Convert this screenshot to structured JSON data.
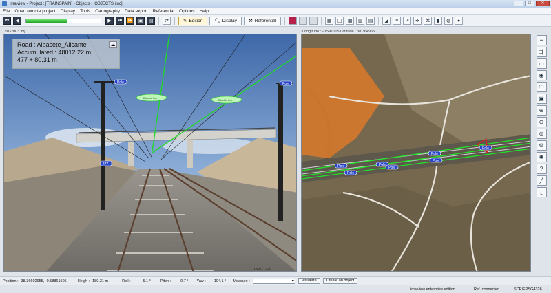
{
  "window": {
    "title": "imajview - Project : [TRAINSPAIN] - Objects : [OBJECTS.itoc]",
    "controls": [
      "–",
      "□",
      "✕"
    ]
  },
  "menu": [
    "File",
    "Open remote project",
    "Display",
    "Tools",
    "Cartography",
    "Data export",
    "Referential",
    "Options",
    "Help"
  ],
  "toolbar": {
    "progress_fraction": 0.55,
    "modes": [
      {
        "label": "Edition",
        "active": true,
        "icon": "pencil-icon"
      },
      {
        "label": "Display",
        "active": false,
        "icon": "magnifier-icon"
      },
      {
        "label": "Referential",
        "active": false,
        "icon": "tools-icon"
      }
    ]
  },
  "left_view": {
    "filename": "s032003.imj",
    "overlay_lines": [
      "Road : Albacete_Alicante",
      "Accumulated : 48012.22 m",
      "477 + 80.31 m"
    ],
    "pixel_readout": "1321,1229",
    "pole_labels": [
      "Pole",
      "Pole",
      "477"
    ],
    "wire_labels": [
      "Electric line",
      "Electric line"
    ]
  },
  "right_view": {
    "coordinates": "Longitude : -0.591015 Latitude : 38.364965",
    "pole_labels": [
      "Pole",
      "Pole",
      "Pole",
      "Pole",
      "Pole",
      "Pole",
      "Pole"
    ]
  },
  "side_tools": [
    "layers-icon",
    "route-icon",
    "ruler-icon",
    "camera-icon",
    "select-icon",
    "image-icon",
    "zoom-in-icon",
    "zoom-out-icon",
    "fit-icon",
    "gear-icon",
    "pin-icon",
    "help-icon",
    "line-icon",
    "corner-icon"
  ],
  "status": {
    "position_label": "Position :",
    "position_value": "38.36602955, -0.58861505",
    "height_label": "Heigh :",
    "height_value": "189.31 m",
    "roll_label": "Roll :",
    "roll_value": "-5.1 °",
    "pitch_label": "Pitch :",
    "pitch_value": "0.7 °",
    "yaw_label": "Yaw :",
    "yaw_value": "104.1 °",
    "measure_label": "Measure :",
    "measure_value": "",
    "visualize_button": "Visualize",
    "create_button": "Create an object"
  },
  "bottom": {
    "edition": "imajview enterprise edition",
    "connection": "Ref. connected",
    "srs": "SCR/EPSG4326"
  },
  "colors": {
    "accent_green": "#22c42a",
    "pole_blue": "#2a46c8",
    "active_mode": "#fff7d8"
  }
}
